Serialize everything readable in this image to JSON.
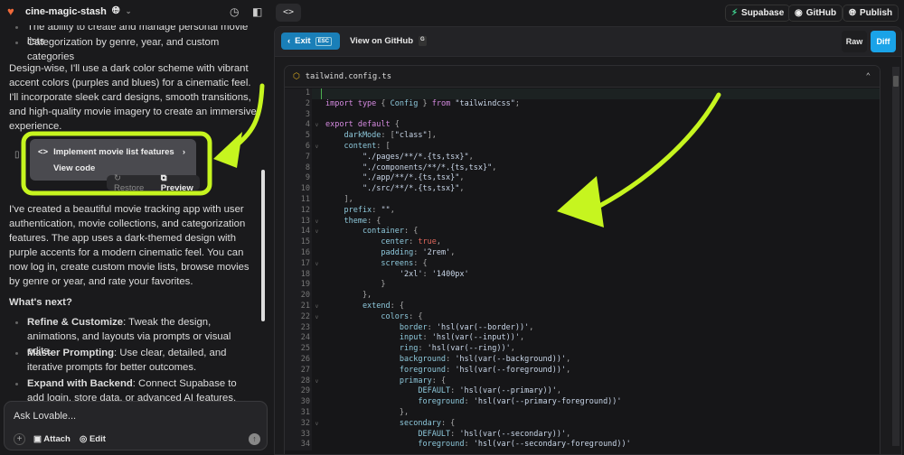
{
  "header": {
    "project": "cine-magic-stash",
    "supabase": "Supabase",
    "github": "GitHub",
    "publish": "Publish"
  },
  "chat": {
    "top_bullets": [
      "The ability to create and manage personal movie lists",
      "Categorization by genre, year, and custom categories"
    ],
    "para1": "Design-wise, I'll use a dark color scheme with vibrant accent colors (purples and blues) for a cinematic feel. I'll incorporate sleek card designs, smooth transitions, and high-quality movie imagery to create an immersive experience.",
    "card": {
      "title": "Implement movie list features",
      "view": "View code",
      "restore": "Restore",
      "preview": "Preview"
    },
    "para2": "I've created a beautiful movie tracking app with user authentication, movie collections, and categorization features. The app uses a dark-themed design with purple accents for a modern cinematic feel. You can now log in, create custom movie lists, browse movies by genre or year, and rate your favorites.",
    "next_heading": "What's next?",
    "next_items": [
      {
        "bold": "Refine & Customize",
        "text": ": Tweak the design, animations, and layouts via prompts or visual edits."
      },
      {
        "bold": "Master Prompting",
        "text": ": Use clear, detailed, and iterative prompts for better outcomes."
      },
      {
        "bold": "Expand with Backend",
        "text": ": Connect Supabase to add login, store data, or advanced AI features."
      }
    ],
    "input_placeholder": "Ask Lovable...",
    "attach": "Attach",
    "edit": "Edit"
  },
  "viewer": {
    "exit": "Exit",
    "esc": "ESC",
    "view_github": "View on GitHub",
    "g_key": "G",
    "raw": "Raw",
    "diff": "Diff",
    "filename": "tailwind.config.ts"
  },
  "colors": {
    "accent": "#1a7fb8",
    "diff": "#1aa3e8",
    "annotation": "#c6f51f"
  },
  "code": [
    [],
    [
      [
        "kw",
        "import type"
      ],
      [
        "pn",
        " { "
      ],
      [
        "prop",
        "Config"
      ],
      [
        "pn",
        " } "
      ],
      [
        "kw",
        "from"
      ],
      [
        "str",
        " \"tailwindcss\""
      ],
      [
        "pn",
        ";"
      ]
    ],
    [],
    [
      [
        "kw",
        "export default"
      ],
      [
        "pn",
        " {"
      ]
    ],
    [
      [
        "prop",
        "    darkMode"
      ],
      [
        "pn",
        ": ["
      ],
      [
        "str",
        "\"class\""
      ],
      [
        "pn",
        "],"
      ]
    ],
    [
      [
        "prop",
        "    content"
      ],
      [
        "pn",
        ": ["
      ]
    ],
    [
      [
        "str",
        "        \"./pages/**/*.{ts,tsx}\""
      ],
      [
        "pn",
        ","
      ]
    ],
    [
      [
        "str",
        "        \"./components/**/*.{ts,tsx}\""
      ],
      [
        "pn",
        ","
      ]
    ],
    [
      [
        "str",
        "        \"./app/**/*.{ts,tsx}\""
      ],
      [
        "pn",
        ","
      ]
    ],
    [
      [
        "str",
        "        \"./src/**/*.{ts,tsx}\""
      ],
      [
        "pn",
        ","
      ]
    ],
    [
      [
        "pn",
        "    ],"
      ]
    ],
    [
      [
        "prop",
        "    prefix"
      ],
      [
        "pn",
        ": "
      ],
      [
        "str",
        "\"\""
      ],
      [
        "pn",
        ","
      ]
    ],
    [
      [
        "prop",
        "    theme"
      ],
      [
        "pn",
        ": {"
      ]
    ],
    [
      [
        "prop",
        "        container"
      ],
      [
        "pn",
        ": {"
      ]
    ],
    [
      [
        "prop",
        "            center"
      ],
      [
        "pn",
        ": "
      ],
      [
        "bool",
        "true"
      ],
      [
        "pn",
        ","
      ]
    ],
    [
      [
        "prop",
        "            padding"
      ],
      [
        "pn",
        ": "
      ],
      [
        "str",
        "'2rem'"
      ],
      [
        "pn",
        ","
      ]
    ],
    [
      [
        "prop",
        "            screens"
      ],
      [
        "pn",
        ": {"
      ]
    ],
    [
      [
        "str",
        "                '2xl'"
      ],
      [
        "pn",
        ": "
      ],
      [
        "str",
        "'1400px'"
      ]
    ],
    [
      [
        "pn",
        "            }"
      ]
    ],
    [
      [
        "pn",
        "        },"
      ]
    ],
    [
      [
        "prop",
        "        extend"
      ],
      [
        "pn",
        ": {"
      ]
    ],
    [
      [
        "prop",
        "            colors"
      ],
      [
        "pn",
        ": {"
      ]
    ],
    [
      [
        "prop",
        "                border"
      ],
      [
        "pn",
        ": "
      ],
      [
        "str",
        "'hsl(var(--border))'"
      ],
      [
        "pn",
        ","
      ]
    ],
    [
      [
        "prop",
        "                input"
      ],
      [
        "pn",
        ": "
      ],
      [
        "str",
        "'hsl(var(--input))'"
      ],
      [
        "pn",
        ","
      ]
    ],
    [
      [
        "prop",
        "                ring"
      ],
      [
        "pn",
        ": "
      ],
      [
        "str",
        "'hsl(var(--ring))'"
      ],
      [
        "pn",
        ","
      ]
    ],
    [
      [
        "prop",
        "                background"
      ],
      [
        "pn",
        ": "
      ],
      [
        "str",
        "'hsl(var(--background))'"
      ],
      [
        "pn",
        ","
      ]
    ],
    [
      [
        "prop",
        "                foreground"
      ],
      [
        "pn",
        ": "
      ],
      [
        "str",
        "'hsl(var(--foreground))'"
      ],
      [
        "pn",
        ","
      ]
    ],
    [
      [
        "prop",
        "                primary"
      ],
      [
        "pn",
        ": {"
      ]
    ],
    [
      [
        "prop",
        "                    DEFAULT"
      ],
      [
        "pn",
        ": "
      ],
      [
        "str",
        "'hsl(var(--primary))'"
      ],
      [
        "pn",
        ","
      ]
    ],
    [
      [
        "prop",
        "                    foreground"
      ],
      [
        "pn",
        ": "
      ],
      [
        "str",
        "'hsl(var(--primary-foreground))'"
      ]
    ],
    [
      [
        "pn",
        "                },"
      ]
    ],
    [
      [
        "prop",
        "                secondary"
      ],
      [
        "pn",
        ": {"
      ]
    ],
    [
      [
        "prop",
        "                    DEFAULT"
      ],
      [
        "pn",
        ": "
      ],
      [
        "str",
        "'hsl(var(--secondary))'"
      ],
      [
        "pn",
        ","
      ]
    ],
    [
      [
        "prop",
        "                    foreground"
      ],
      [
        "pn",
        ": "
      ],
      [
        "str",
        "'hsl(var(--secondary-foreground))'"
      ]
    ]
  ],
  "folds": [
    4,
    6,
    13,
    14,
    17,
    21,
    22,
    28,
    32
  ]
}
